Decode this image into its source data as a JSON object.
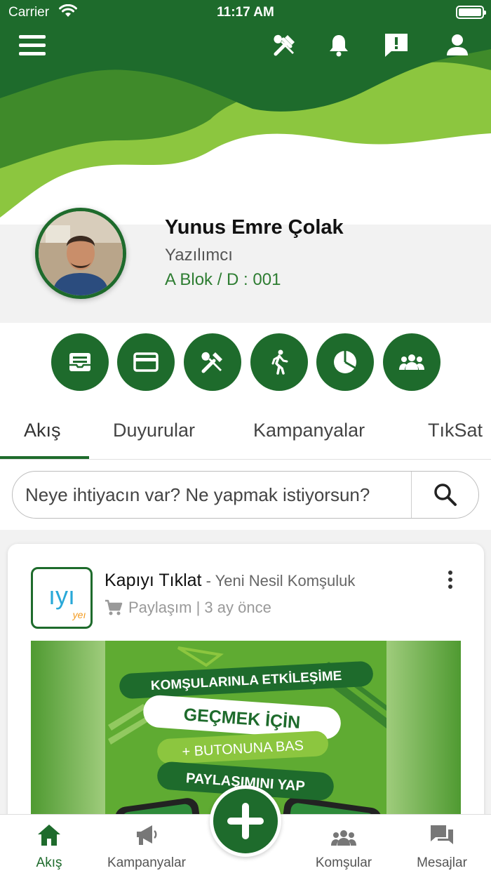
{
  "status_bar": {
    "carrier": "Carrier",
    "time": "11:17 AM"
  },
  "header": {
    "icons": [
      "menu-icon",
      "tools-icon",
      "bell-icon",
      "feedback-icon",
      "user-icon"
    ],
    "colors": {
      "dark_green": "#1e6b2c",
      "mid_green": "#3a8a2a",
      "light_green": "#8cc63f"
    }
  },
  "profile": {
    "name": "Yunus Emre Çolak",
    "role": "Yazılımcı",
    "unit": "A Blok / D : 001"
  },
  "quick_actions": [
    "inbox-icon",
    "card-icon",
    "tools-icon",
    "walk-icon",
    "pie-chart-icon",
    "group-icon"
  ],
  "tabs": [
    {
      "label": "Akış",
      "active": true
    },
    {
      "label": "Duyurular"
    },
    {
      "label": "Kampanyalar"
    },
    {
      "label": "TıkSat"
    }
  ],
  "search": {
    "placeholder": "Neye ihtiyacın var? Ne yapmak istiyorsun?"
  },
  "post": {
    "author": "Kapıyı Tıklat",
    "separator": " - ",
    "subtitle": "Yeni Nesil Komşuluk",
    "meta": "Paylaşım | 3 ay önce",
    "logo_text": "ıyı",
    "logo_sub": "yeı",
    "banner": {
      "line1": "KOMŞULARINLA ETKİLEŞİME",
      "line2": "GEÇMEK İÇİN",
      "line3": "+ BUTONUNA BAS",
      "line4": "PAYLAŞIMINI YAP"
    }
  },
  "bottom_nav": [
    {
      "label": "Akış",
      "icon": "home-icon",
      "active": true
    },
    {
      "label": "Kampanyalar",
      "icon": "megaphone-icon"
    },
    {
      "label": "Komşular",
      "icon": "neighbors-icon"
    },
    {
      "label": "Mesajlar",
      "icon": "chat-icon"
    }
  ]
}
